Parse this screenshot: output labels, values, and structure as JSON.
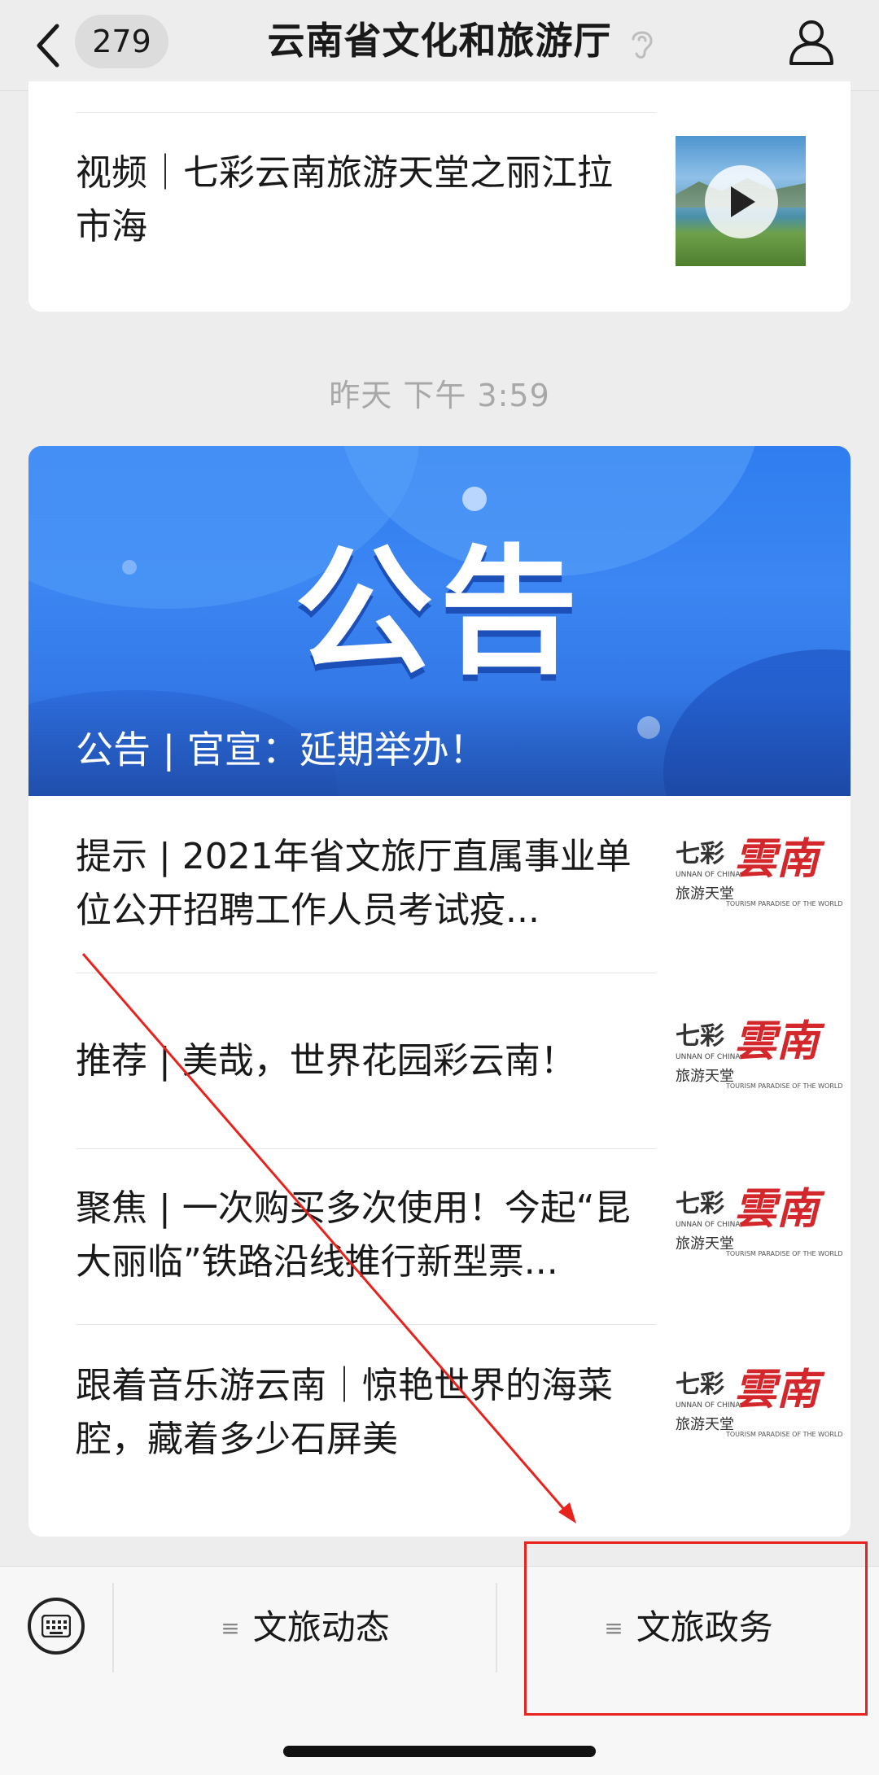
{
  "header": {
    "unread_count": "279",
    "title": "云南省文化和旅游厅"
  },
  "card_top": {
    "article_title": "视频｜七彩云南旅游天堂之丽江拉市海"
  },
  "timestamp": "昨天 下午 3:59",
  "card_main": {
    "banner_text": "公告",
    "banner_caption": "公告 | 官宣：延期举办！",
    "articles": [
      {
        "title": "提示 | 2021年省文旅厅直属事业单位公开招聘工作人员考试疫..."
      },
      {
        "title": "推荐 | 美哉，世界花园彩云南！"
      },
      {
        "title": "聚焦 | 一次购买多次使用！今起“昆大丽临”铁路沿线推行新型票..."
      },
      {
        "title": "跟着音乐游云南｜惊艳世界的海菜腔，藏着多少石屏美"
      }
    ],
    "thumb_logo": {
      "qi": "七彩",
      "line1": "UNNAN OF CHINA",
      "lvy": "旅游天堂",
      "yunnan": "雲南",
      "tag": "TOURISM PARADISE OF THE WORLD"
    }
  },
  "bottom_menu": {
    "items": [
      {
        "label": "文旅动态"
      },
      {
        "label": "文旅政务"
      }
    ]
  },
  "colors": {
    "banner_blue": "#2f7df0",
    "annotation_red": "#e8231e",
    "logo_red": "#d4272c"
  }
}
